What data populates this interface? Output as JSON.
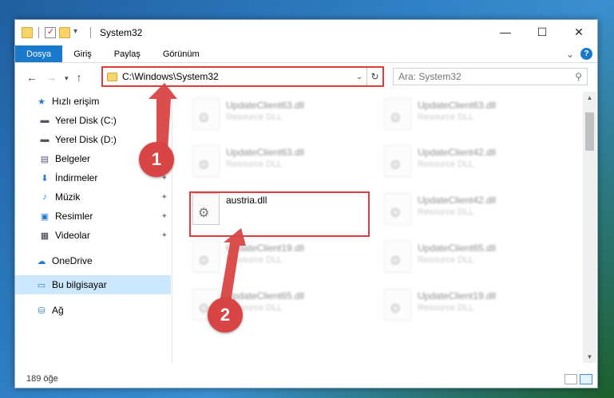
{
  "window": {
    "title": "System32",
    "buttons": {
      "minimize": "—",
      "maximize": "☐",
      "close": "✕"
    }
  },
  "ribbon": {
    "tabs": [
      "Dosya",
      "Giriş",
      "Paylaş",
      "Görünüm"
    ],
    "expand": "⌄",
    "help": "?"
  },
  "address": {
    "path": "C:\\Windows\\System32",
    "dropdown": "⌄",
    "refresh": "↻"
  },
  "search": {
    "placeholder": "Ara: System32"
  },
  "sidebar": {
    "quick_access": "Hızlı erişim",
    "items": [
      {
        "label": "Yerel Disk (C:)",
        "icon": "drive-icon"
      },
      {
        "label": "Yerel Disk (D:)",
        "icon": "drive-icon"
      },
      {
        "label": "Belgeler",
        "icon": "documents-icon"
      },
      {
        "label": "İndirmeler",
        "icon": "downloads-icon"
      },
      {
        "label": "Müzik",
        "icon": "music-icon"
      },
      {
        "label": "Resimler",
        "icon": "pictures-icon"
      },
      {
        "label": "Videolar",
        "icon": "videos-icon"
      }
    ],
    "onedrive": "OneDrive",
    "this_pc": "Bu bilgisayar",
    "network": "Ağ"
  },
  "files": {
    "col1": [
      {
        "name": "UpdateClient63.dll",
        "type": "Resource DLL"
      },
      {
        "name": "UpdateClient63.dll",
        "type": "Resource DLL"
      },
      {
        "name": "austria.dll",
        "type": ""
      },
      {
        "name": "UpdateClient19.dll",
        "type": "Resource DLL"
      },
      {
        "name": "UpdateClient65.dll",
        "type": "Resource DLL"
      }
    ],
    "col2": [
      {
        "name": "UpdateClient63.dll",
        "type": "Resource DLL"
      },
      {
        "name": "UpdateClient42.dll",
        "type": "Resource DLL"
      },
      {
        "name": "UpdateClient42.dll",
        "type": "Resource DLL"
      },
      {
        "name": "UpdateClient65.dll",
        "type": "Resource DLL"
      },
      {
        "name": "UpdateClient19.dll",
        "type": "Resource DLL"
      }
    ]
  },
  "status": {
    "count": "189 öğe"
  },
  "markers": {
    "one": "1",
    "two": "2"
  },
  "colors": {
    "accent": "#1979ca",
    "highlight": "#e03a3a"
  }
}
